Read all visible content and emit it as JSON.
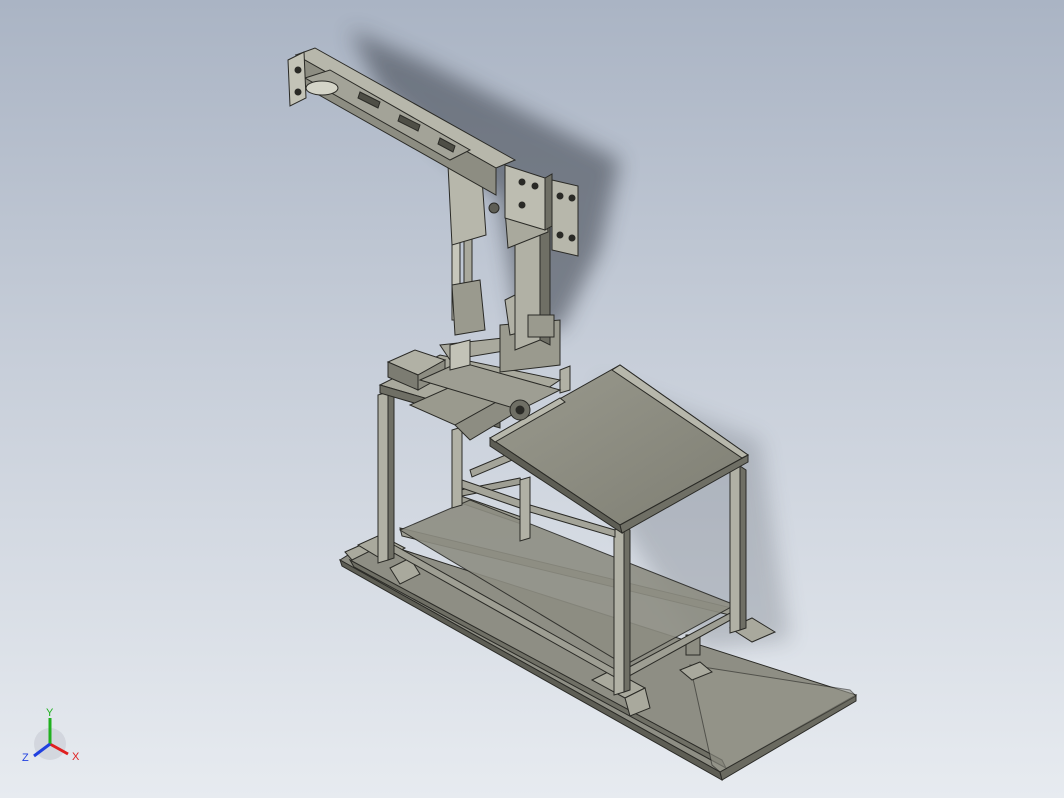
{
  "viewport": {
    "background_top": "#aab4c4",
    "background_bottom": "#e7ebf0"
  },
  "model": {
    "metal_color": "#8d8d82",
    "metal_light": "#a9a99d",
    "metal_dark": "#5e5e55",
    "edge_color": "#2a2a26"
  },
  "triad": {
    "x_label": "X",
    "y_label": "Y",
    "z_label": "Z",
    "x_color": "#e02020",
    "y_color": "#20b020",
    "z_color": "#2040e0"
  }
}
